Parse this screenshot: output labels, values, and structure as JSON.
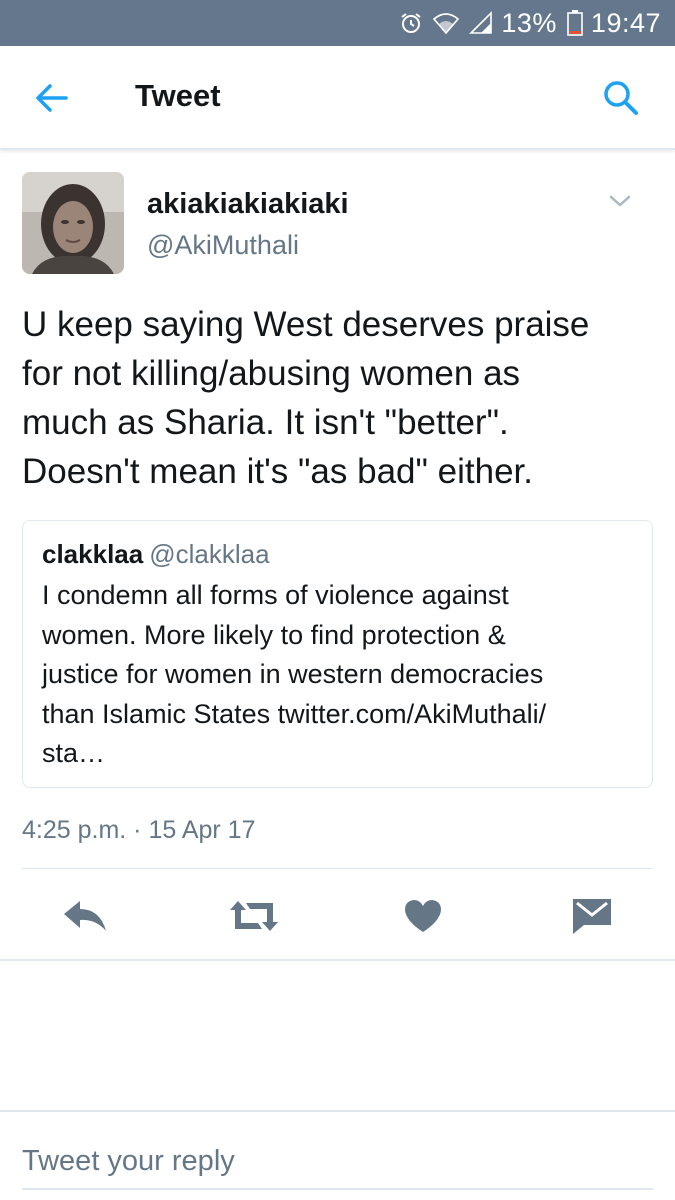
{
  "status_bar": {
    "battery": "13%",
    "time": "19:47",
    "icons": [
      "alarm-icon",
      "wifi-icon",
      "signal-icon",
      "battery-icon"
    ]
  },
  "header": {
    "title": "Tweet",
    "back_icon": "back-arrow-icon",
    "search_icon": "search-icon"
  },
  "tweet": {
    "author_name": "akiakiakiakiaki",
    "author_handle": "@AkiMuthali",
    "text_lines": [
      "U keep saying West deserves praise",
      "for not killing/abusing women as",
      "much as Sharia. It isn't \"better\".",
      "Doesn't mean it's \"as bad\" either."
    ],
    "timestamp": "4:25 p.m. · 15 Apr 17"
  },
  "quoted_tweet": {
    "author_name": "clakklaa",
    "author_handle": "@clakklaa",
    "text_lines": [
      "I condemn all forms of violence against",
      "women. More likely to find protection &",
      "justice for women in western democracies",
      "than Islamic States twitter.com/AkiMuthali/",
      "sta…"
    ]
  },
  "actions": [
    "reply-icon",
    "retweet-icon",
    "like-icon",
    "message-icon"
  ],
  "colors": {
    "status_bar": "#65778d",
    "accent": "#1da1f2",
    "icon_gray": "#657786",
    "text": "#14171a",
    "border": "#e1e8ed"
  },
  "reply": {
    "placeholder": "Tweet your reply"
  }
}
